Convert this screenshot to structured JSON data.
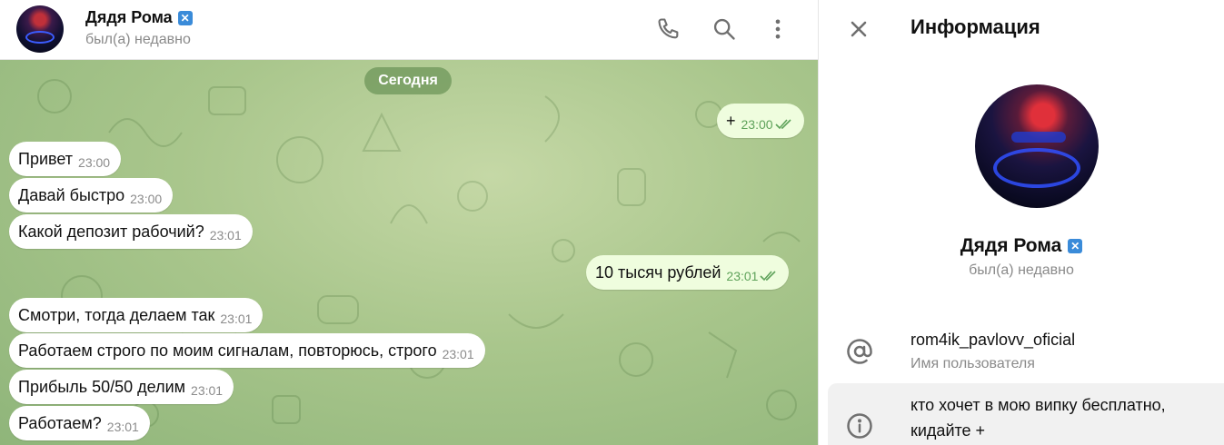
{
  "chat": {
    "name": "Дядя Рома",
    "status": "был(а) недавно",
    "date_label": "Сегодня",
    "messages": [
      {
        "text": "+",
        "time": "23:00",
        "direction": "out"
      },
      {
        "text": "Привет",
        "time": "23:00",
        "direction": "in"
      },
      {
        "text": "Давай быстро",
        "time": "23:00",
        "direction": "in"
      },
      {
        "text": "Какой депозит рабочий?",
        "time": "23:01",
        "direction": "in"
      },
      {
        "text": "10 тысяч рублей",
        "time": "23:01",
        "direction": "out"
      },
      {
        "text": "Смотри, тогда делаем так",
        "time": "23:01",
        "direction": "in"
      },
      {
        "text": "Работаем строго по моим сигналам, повторюсь, строго",
        "time": "23:01",
        "direction": "in"
      },
      {
        "text": "Прибыль 50/50 делим",
        "time": "23:01",
        "direction": "in"
      },
      {
        "text": "Работаем?",
        "time": "23:01",
        "direction": "in"
      }
    ]
  },
  "header_icons": [
    "phone-icon",
    "search-icon",
    "more-vertical-icon"
  ],
  "info": {
    "title": "Информация",
    "name": "Дядя Рома",
    "status": "был(а) недавно",
    "username": "rom4ik_pavlovv_oficial",
    "username_caption": "Имя пользователя",
    "bio_line1": "кто хочет в мою випку бесплатно,",
    "bio_line2": "кидайте +"
  },
  "verified_mark": "✕",
  "colors": {
    "accent": "#3a8bd9",
    "outgoing_bubble": "#effdde",
    "incoming_bubble": "#ffffff",
    "chat_background": "#a9c68c",
    "read_checks": "#5ea25a"
  }
}
